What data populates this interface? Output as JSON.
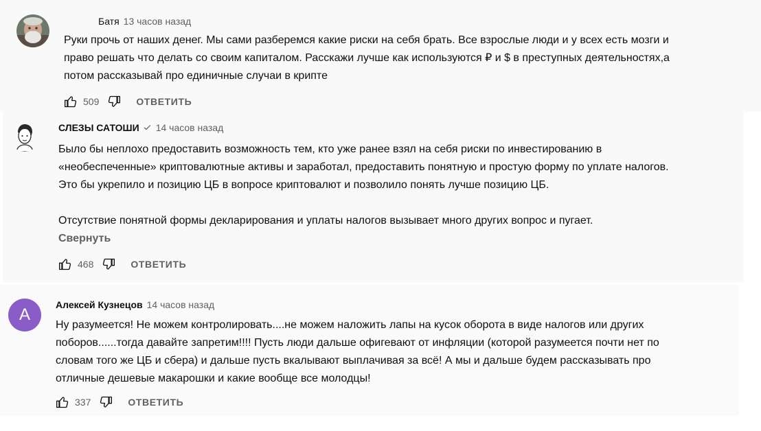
{
  "comments": [
    {
      "author": "Батя",
      "time": "13 часов назад",
      "text_lines": [
        "Руки прочь от наших денег. Мы сами разберемся какие риски на себя брать. Все взрослые люди и у всех есть мозги и",
        "право решать что делать со своим капиталом. Расскажи лучше как используются ₽ и $ в преступных деятельностях,а",
        "потом рассказывай про единичные случаи в крипте"
      ],
      "likes": "509",
      "reply_label": "ОТВЕТИТЬ"
    },
    {
      "author": "СЛЕЗЫ САТОШИ",
      "verified": true,
      "time": "14 часов назад",
      "text_lines": [
        "Было бы неплохо предоставить возможность тем, кто уже ранее взял на себя риски по инвестированию в",
        "«необеспеченные» криптовалютные активы и заработал, предоставить понятную и простую форму по уплате налогов.",
        "Это бы укрепило и позицию ЦБ в вопросе криптовалют и позволило понять лучше позицию ЦБ.",
        "",
        "Отсутствие понятной формы декларирования и уплаты налогов вызывает много других вопрос и пугает."
      ],
      "collapse_label": "Свернуть",
      "likes": "468",
      "reply_label": "ОТВЕТИТЬ"
    },
    {
      "author": "Алексей Кузнецов",
      "avatar_letter": "A",
      "avatar_color": "#8a5cc7",
      "time": "14 часов назад",
      "text_lines": [
        "Ну разумеется! Не можем контролировать....не можем наложить лапы на кусок оборота в виде налогов или других",
        "поборов......тогда давайте запретим!!!! Пусть люди дальше офигевают от инфляции (которой разумеется почти нет по",
        "словам того же ЦБ и сбера) и дальше пусть вкалывают выплачивая за всё! А мы и дальше будем рассказывать про",
        "отличные дешевые макарошки и какие вообще все молодцы!"
      ],
      "likes": "337",
      "reply_label": "ОТВЕТИТЬ"
    }
  ]
}
